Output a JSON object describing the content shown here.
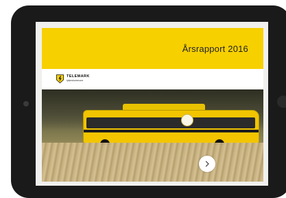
{
  "report": {
    "title": "Årsrapport 2016"
  },
  "logo": {
    "name": "TELEMARK",
    "subtitle": "fylkeskommune"
  },
  "colors": {
    "banner": "#f7d000",
    "tablet": "#1a1a1a"
  },
  "icons": {
    "next": "chevron-right-icon",
    "logo": "lightning-shield-icon"
  }
}
